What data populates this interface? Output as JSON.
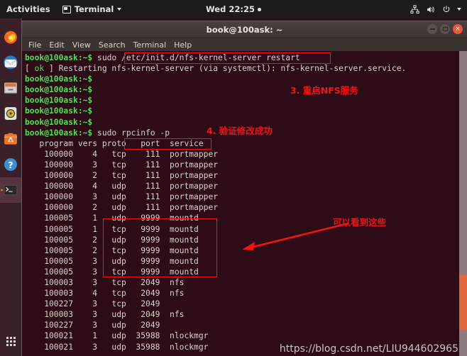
{
  "topbar": {
    "activities": "Activities",
    "app_name": "Terminal",
    "clock": "Wed 22:25",
    "tray_icons": [
      "network-icon",
      "volume-icon",
      "power-icon",
      "chevron-down-icon"
    ]
  },
  "dock": {
    "items": [
      {
        "name": "firefox",
        "label": "Firefox"
      },
      {
        "name": "thunderbird",
        "label": "Thunderbird Mail"
      },
      {
        "name": "files",
        "label": "Files"
      },
      {
        "name": "rhythmbox",
        "label": "Rhythmbox"
      },
      {
        "name": "ubuntu-software",
        "label": "Ubuntu Software"
      },
      {
        "name": "help",
        "label": "Help"
      },
      {
        "name": "terminal",
        "label": "Terminal"
      }
    ],
    "show_applications": "Show Applications"
  },
  "window": {
    "title": "book@100ask: ~",
    "buttons": {
      "minimize": "minimize",
      "maximize": "maximize",
      "close": "close"
    },
    "menu": [
      "File",
      "Edit",
      "View",
      "Search",
      "Terminal",
      "Help"
    ]
  },
  "terminal": {
    "prompt": "book@100ask:~$",
    "lines": [
      {
        "type": "cmd",
        "prompt": "book@100ask:~$",
        "text": " sudo /etc/init.d/nfs-kernel-server restart"
      },
      {
        "type": "ok",
        "pre": "[ ",
        "status": "ok",
        "post": " ] Restarting nfs-kernel-server (via systemctl): nfs-kernel-server.service."
      },
      {
        "type": "prompt",
        "prompt": "book@100ask:~$",
        "text": ""
      },
      {
        "type": "prompt",
        "prompt": "book@100ask:~$",
        "text": ""
      },
      {
        "type": "prompt",
        "prompt": "book@100ask:~$",
        "text": ""
      },
      {
        "type": "prompt",
        "prompt": "book@100ask:~$",
        "text": ""
      },
      {
        "type": "prompt",
        "prompt": "book@100ask:~$",
        "text": ""
      },
      {
        "type": "cmd",
        "prompt": "book@100ask:~$",
        "text": " sudo rpcinfo -p"
      }
    ],
    "table_header": "   program vers proto   port  service",
    "table_rows": [
      "    100000    4   tcp    111  portmapper",
      "    100000    3   tcp    111  portmapper",
      "    100000    2   tcp    111  portmapper",
      "    100000    4   udp    111  portmapper",
      "    100000    3   udp    111  portmapper",
      "    100000    2   udp    111  portmapper",
      "    100005    1   udp   9999  mountd",
      "    100005    1   tcp   9999  mountd",
      "    100005    2   udp   9999  mountd",
      "    100005    2   tcp   9999  mountd",
      "    100005    3   udp   9999  mountd",
      "    100005    3   tcp   9999  mountd",
      "    100003    3   tcp   2049  nfs",
      "    100003    4   tcp   2049  nfs",
      "    100227    3   tcp   2049",
      "    100003    3   udp   2049  nfs",
      "    100227    3   udp   2049",
      "    100021    1   udp  35988  nlockmgr",
      "    100021    3   udp  35988  nlockmgr"
    ]
  },
  "annotations": {
    "note_restart": "3. 重启NFS服务",
    "note_verify": "4. 验证修改成功",
    "note_see": "可以看到这些",
    "color": "#f41414"
  },
  "watermark": "https://blog.csdn.net/LIU944602965"
}
